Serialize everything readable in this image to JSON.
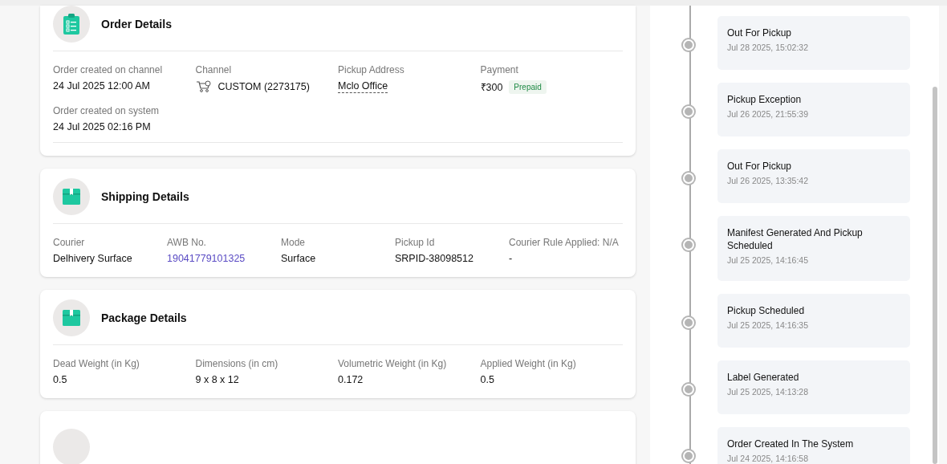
{
  "sections": [
    {
      "kind": "order",
      "title": "Order Details",
      "rows": [
        [
          {
            "kind": "text",
            "label": "Order created on channel",
            "value": "24 Jul 2025 12:00 AM"
          },
          {
            "kind": "channel",
            "label": "Channel",
            "value": "CUSTOM (2273175)"
          },
          {
            "kind": "address",
            "label": "Pickup Address",
            "value": "Mclo Office"
          },
          {
            "kind": "payment",
            "label": "Payment",
            "value": "₹300",
            "badge": "Prepaid"
          }
        ],
        [
          {
            "kind": "text",
            "label": "Order created on system",
            "value": "24 Jul 2025 02:16 PM"
          }
        ]
      ]
    },
    {
      "kind": "parcel",
      "title": "Shipping Details",
      "rows": [
        [
          {
            "kind": "text",
            "label": "Courier",
            "value": "Delhivery Surface"
          },
          {
            "kind": "link",
            "label": "AWB No.",
            "value": "19041779101325"
          },
          {
            "kind": "text",
            "label": "Mode",
            "value": "Surface"
          },
          {
            "kind": "text",
            "label": "Pickup Id",
            "value": "SRPID-38098512"
          },
          {
            "kind": "text",
            "label": "Courier Rule Applied: N/A",
            "value": "-"
          }
        ]
      ]
    },
    {
      "kind": "parcel",
      "title": "Package Details",
      "rows": [
        [
          {
            "kind": "text",
            "label": "Dead Weight (in Kg)",
            "value": "0.5"
          },
          {
            "kind": "text",
            "label": "Dimensions (in cm)",
            "value": "9 x 8 x 12"
          },
          {
            "kind": "text",
            "label": "Volumetric Weight (in Kg)",
            "value": "0.172"
          },
          {
            "kind": "text",
            "label": "Applied Weight (in Kg)",
            "value": "0.5"
          }
        ]
      ]
    },
    {
      "kind": "empty"
    }
  ],
  "tracking": [
    {
      "status": "Out For Pickup",
      "time": "Jul 28 2025, 15:02:32"
    },
    {
      "status": "Pickup Exception",
      "time": "Jul 26 2025, 21:55:39"
    },
    {
      "status": "Out For Pickup",
      "time": "Jul 26 2025, 13:35:42"
    },
    {
      "status": "Manifest Generated And Pickup Scheduled",
      "time": "Jul 25 2025, 14:16:45"
    },
    {
      "status": "Pickup Scheduled",
      "time": "Jul 25 2025, 14:16:35"
    },
    {
      "status": "Label Generated",
      "time": "Jul 25 2025, 14:13:28"
    },
    {
      "status": "Order Created In The System",
      "time": "Jul 24 2025, 14:16:58"
    }
  ]
}
